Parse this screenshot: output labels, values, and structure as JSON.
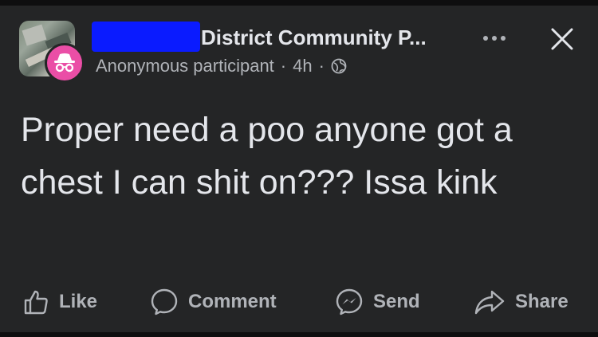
{
  "post": {
    "group_name": "District Community P...",
    "author": "Anonymous participant",
    "separator": "·",
    "time": "4h",
    "text": "Proper need a poo anyone got a chest I can shit on??? Issa kink"
  },
  "actions": {
    "like": "Like",
    "comment": "Comment",
    "send": "Send",
    "share": "Share"
  },
  "icons": {
    "more": "more-horizontal-icon",
    "close": "close-icon",
    "privacy": "globe-icon",
    "anonymous": "incognito-icon"
  },
  "colors": {
    "background": "#242526",
    "text": "#e4e6eb",
    "secondary_text": "#b0b3b8",
    "anon_badge": "#ea4ea6",
    "redaction": "#0a1bff"
  }
}
